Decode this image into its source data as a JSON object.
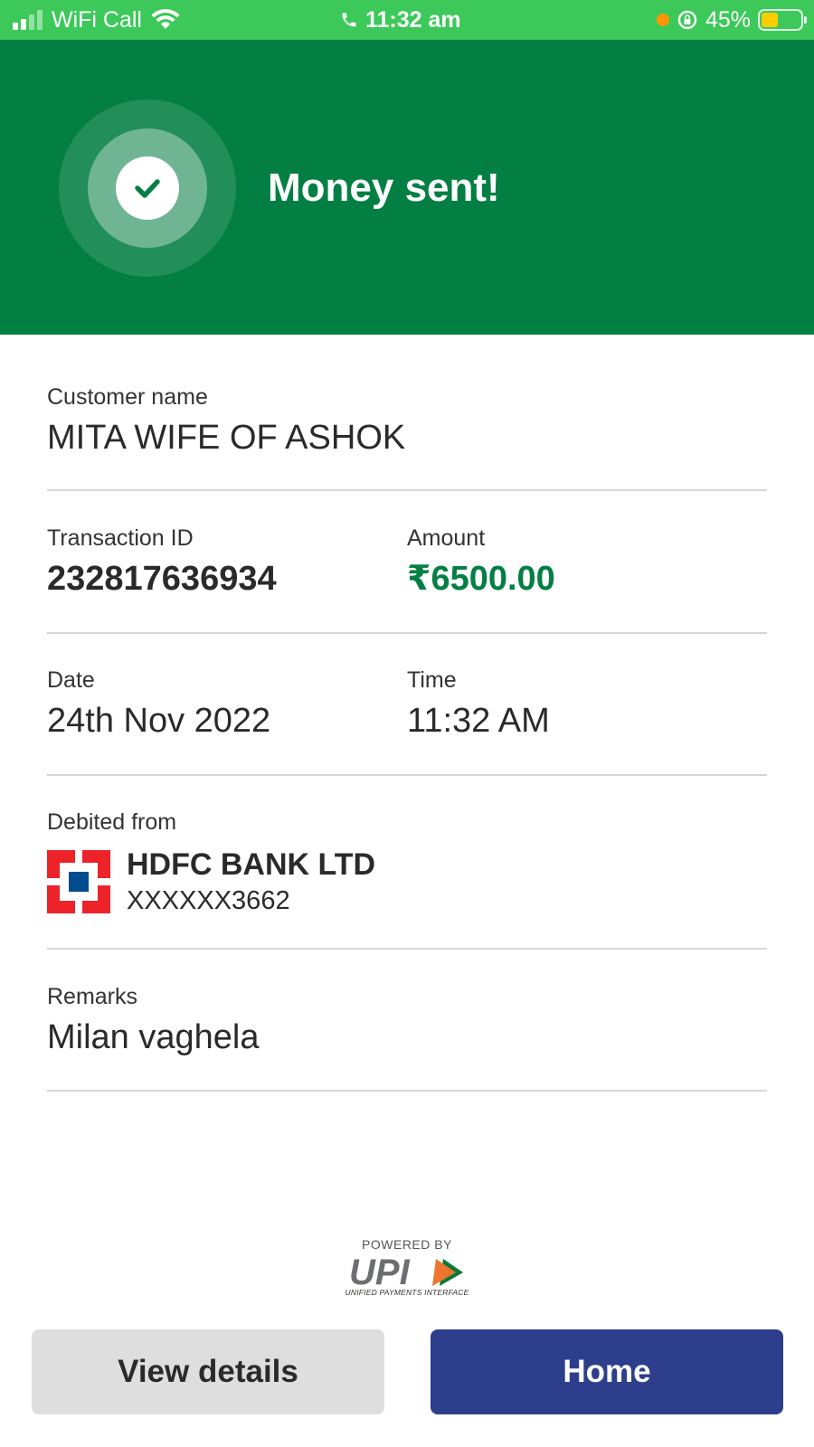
{
  "status_bar": {
    "carrier": "WiFi Call",
    "time": "11:32 am",
    "battery": "45%",
    "battery_level": 0.45
  },
  "header": {
    "title": "Money sent!"
  },
  "customer": {
    "label": "Customer name",
    "value": "MITA WIFE OF ASHOK"
  },
  "transaction": {
    "id_label": "Transaction ID",
    "id_value": "232817636934",
    "amount_label": "Amount",
    "amount_value": "₹6500.00"
  },
  "datetime": {
    "date_label": "Date",
    "date_value": "24th Nov 2022",
    "time_label": "Time",
    "time_value": "11:32 AM"
  },
  "debit": {
    "label": "Debited from",
    "bank_name": "HDFC BANK LTD",
    "account": "XXXXXX3662"
  },
  "remarks": {
    "label": "Remarks",
    "value": "Milan vaghela"
  },
  "upi": {
    "powered_by": "POWERED BY",
    "logo_text": "UPI",
    "subtitle": "UNIFIED PAYMENTS INTERFACE"
  },
  "buttons": {
    "view_details": "View details",
    "home": "Home"
  },
  "colors": {
    "status_bar": "#3cc95a",
    "header": "#047f44",
    "amount": "#047f44",
    "home_button": "#2d3f8c",
    "view_button": "#dedede"
  }
}
